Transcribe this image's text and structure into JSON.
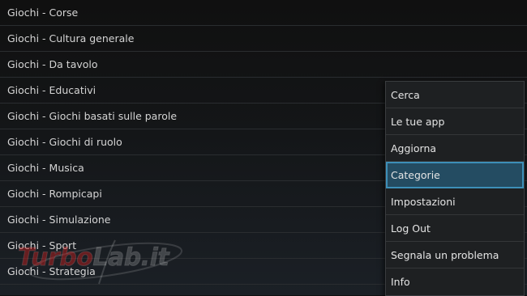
{
  "categories": [
    "Giochi - Corse",
    "Giochi - Cultura generale",
    "Giochi - Da tavolo",
    "Giochi - Educativi",
    "Giochi - Giochi basati sulle parole",
    "Giochi - Giochi di ruolo",
    "Giochi - Musica",
    "Giochi - Rompicapi",
    "Giochi - Simulazione",
    "Giochi - Sport",
    "Giochi - Strategia"
  ],
  "menu": {
    "items": [
      "Cerca",
      "Le tue app",
      "Aggiorna",
      "Categorie",
      "Impostazioni",
      "Log Out",
      "Segnala un problema",
      "Info"
    ],
    "selected": "Categorie"
  },
  "watermark": {
    "text_part1": "Turbo",
    "text_part2": "Lab.it"
  },
  "colors": {
    "selected_bg": "#244c62",
    "selected_border": "#3d8fb8",
    "watermark_red": "#c81e1e"
  }
}
